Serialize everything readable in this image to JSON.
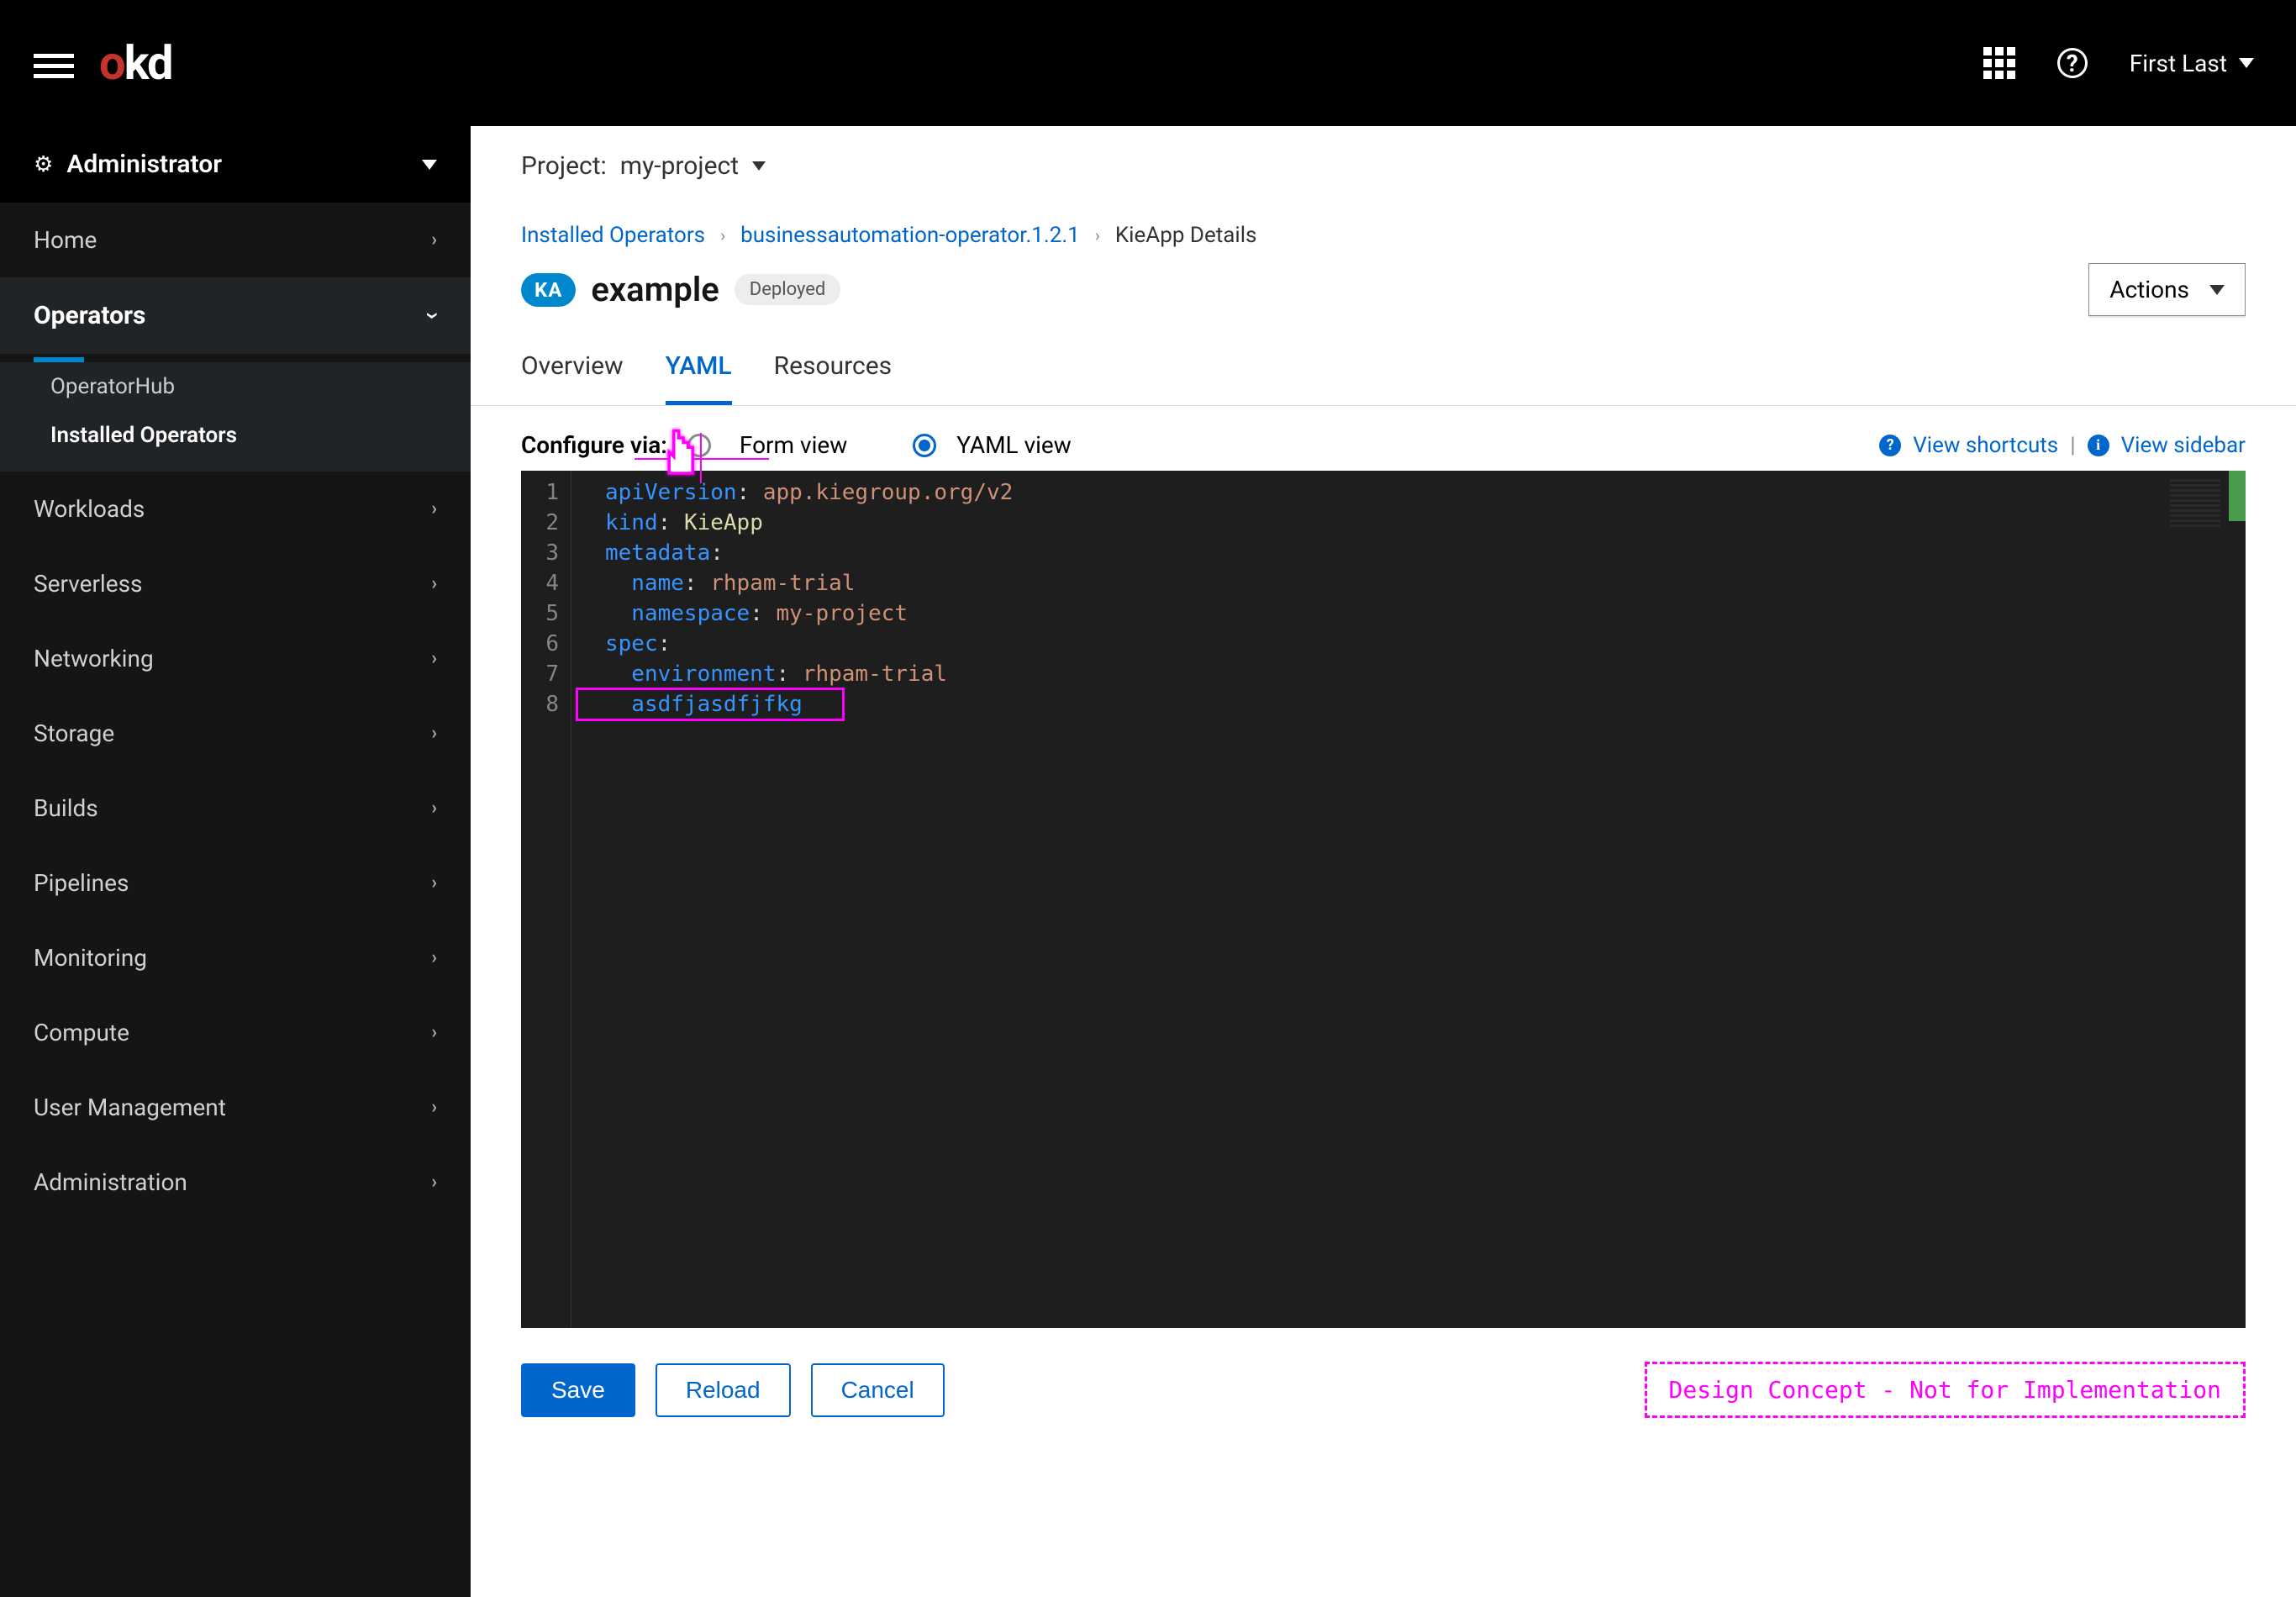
{
  "topbar": {
    "logo_text": "okd",
    "user_name": "First Last"
  },
  "sidebar": {
    "perspective": "Administrator",
    "items": [
      {
        "label": "Home",
        "expanded": false
      },
      {
        "label": "Operators",
        "expanded": true,
        "children": [
          "OperatorHub",
          "Installed Operators"
        ],
        "active_child": "Installed Operators"
      },
      {
        "label": "Workloads",
        "expanded": false
      },
      {
        "label": "Serverless",
        "expanded": false
      },
      {
        "label": "Networking",
        "expanded": false
      },
      {
        "label": "Storage",
        "expanded": false
      },
      {
        "label": "Builds",
        "expanded": false
      },
      {
        "label": "Pipelines",
        "expanded": false
      },
      {
        "label": "Monitoring",
        "expanded": false
      },
      {
        "label": "Compute",
        "expanded": false
      },
      {
        "label": "User Management",
        "expanded": false
      },
      {
        "label": "Administration",
        "expanded": false
      }
    ]
  },
  "project": {
    "label": "Project:",
    "name": "my-project"
  },
  "breadcrumb": {
    "items": [
      "Installed Operators",
      "businessautomation-operator.1.2.1",
      "KieApp Details"
    ]
  },
  "resource": {
    "badge": "KA",
    "name": "example",
    "status": "Deployed",
    "actions_label": "Actions"
  },
  "tabs": {
    "overview": "Overview",
    "yaml": "YAML",
    "resources": "Resources",
    "active": "yaml"
  },
  "configure": {
    "label": "Configure via:",
    "form_label": "Form view",
    "yaml_label": "YAML view",
    "selected": "yaml",
    "shortcuts": "View shortcuts",
    "sidebar_link": "View sidebar"
  },
  "yaml": {
    "lines": [
      {
        "n": 1,
        "key": "apiVersion",
        "val": "app.kiegroup.org/v2"
      },
      {
        "n": 2,
        "key": "kind",
        "val": "KieApp"
      },
      {
        "n": 3,
        "key": "metadata",
        "val": ""
      },
      {
        "n": 4,
        "key": "  name",
        "val": "rhpam-trial"
      },
      {
        "n": 5,
        "key": "  namespace",
        "val": "my-project"
      },
      {
        "n": 6,
        "key": "spec",
        "val": ""
      },
      {
        "n": 7,
        "key": "  environment",
        "val": "rhpam-trial"
      },
      {
        "n": 8,
        "raw": "  asdfjasdfjfkg"
      }
    ]
  },
  "footer": {
    "save": "Save",
    "reload": "Reload",
    "cancel": "Cancel",
    "design_note": "Design Concept - Not for Implementation"
  }
}
